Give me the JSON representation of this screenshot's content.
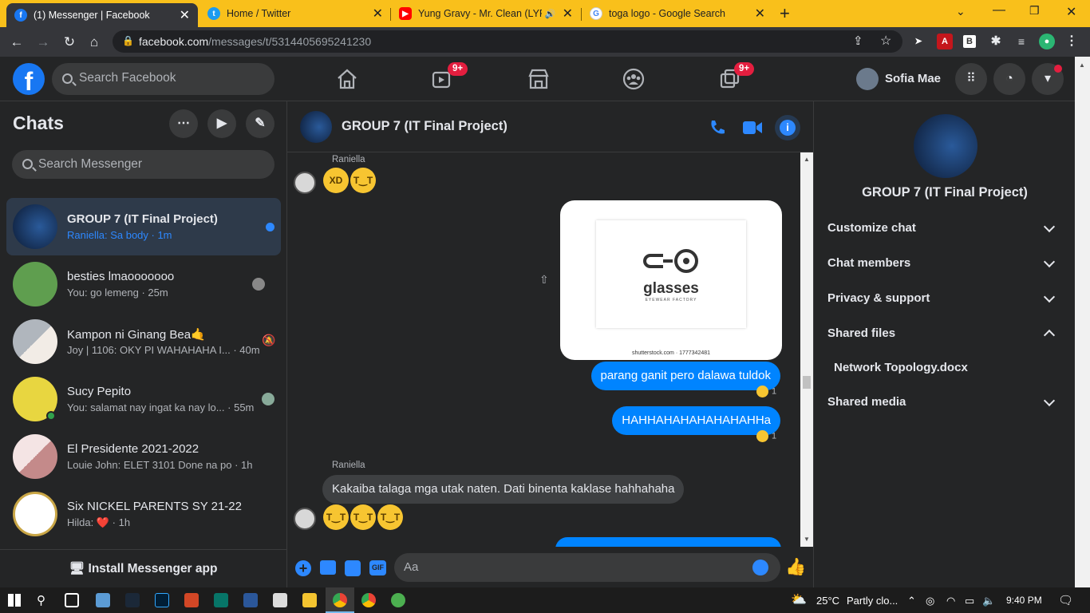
{
  "browser": {
    "tabs": [
      {
        "title": "(1) Messenger | Facebook",
        "icon": "facebook-icon",
        "color": "#1877f2"
      },
      {
        "title": "Home / Twitter",
        "icon": "twitter-icon",
        "color": "#1d9bf0"
      },
      {
        "title": "Yung Gravy - Mr. Clean (LYRI",
        "icon": "youtube-icon",
        "color": "#ff0000"
      },
      {
        "title": "toga logo - Google Search",
        "icon": "google-icon",
        "color": "#4285f4"
      }
    ],
    "url_domain": "facebook.com",
    "url_path": "/messages/t/5314405695241230"
  },
  "facebook": {
    "search_placeholder": "Search Facebook",
    "user_name": "Sofia Mae",
    "watch_badge": "9+",
    "gaming_badge": "9+"
  },
  "chats_panel": {
    "title": "Chats",
    "search_placeholder": "Search Messenger",
    "install_label": "Install Messenger app",
    "conversations": [
      {
        "name": "GROUP 7 (IT Final Project)",
        "preview": "Raniella: Sa body · 1m"
      },
      {
        "name": "besties lmaooooooo",
        "preview": "You: go lemeng · 25m"
      },
      {
        "name": "Kampon ni Ginang Bea🤙",
        "preview": "Joy | 1106: OKY PI WAHAHAHA I... · 40m"
      },
      {
        "name": "Sucy Pepito",
        "preview": "You: salamat nay ingat ka nay lo... · 55m"
      },
      {
        "name": "El Presidente 2021-2022",
        "preview": "Louie John: ELET 3101 Done na po · 1h"
      },
      {
        "name": "Six NICKEL PARENTS SY 21-22",
        "preview": "Hilda: ❤️ · 1h"
      }
    ]
  },
  "conversation": {
    "title": "GROUP 7 (IT Final Project)",
    "sender_1": "Raniella",
    "sender_2": "Raniella",
    "image_logo_text": "glasses",
    "image_logo_sub": "EYEWEAR FACTORY",
    "image_watermark": "shutterstock.com · 1777342481",
    "msg_out_1": "parang ganit pero dalawa tuldok",
    "msg_out_1_reactions": "1",
    "msg_out_2": "HAHHAHAHAHAHAHAHHa",
    "msg_out_2_reactions": "1",
    "msg_in_1": "Kakaiba talaga mga utak naten. Dati binenta kaklase hahhahaha",
    "composer_placeholder": "Aa"
  },
  "info_panel": {
    "title": "GROUP 7 (IT Final Project)",
    "customize": "Customize chat",
    "members": "Chat members",
    "privacy": "Privacy & support",
    "shared_files": "Shared files",
    "file_1": "Network Topology.docx",
    "shared_media": "Shared media"
  },
  "taskbar": {
    "temperature": "25°C",
    "weather": "Partly clo...",
    "time": "9:40 PM"
  }
}
